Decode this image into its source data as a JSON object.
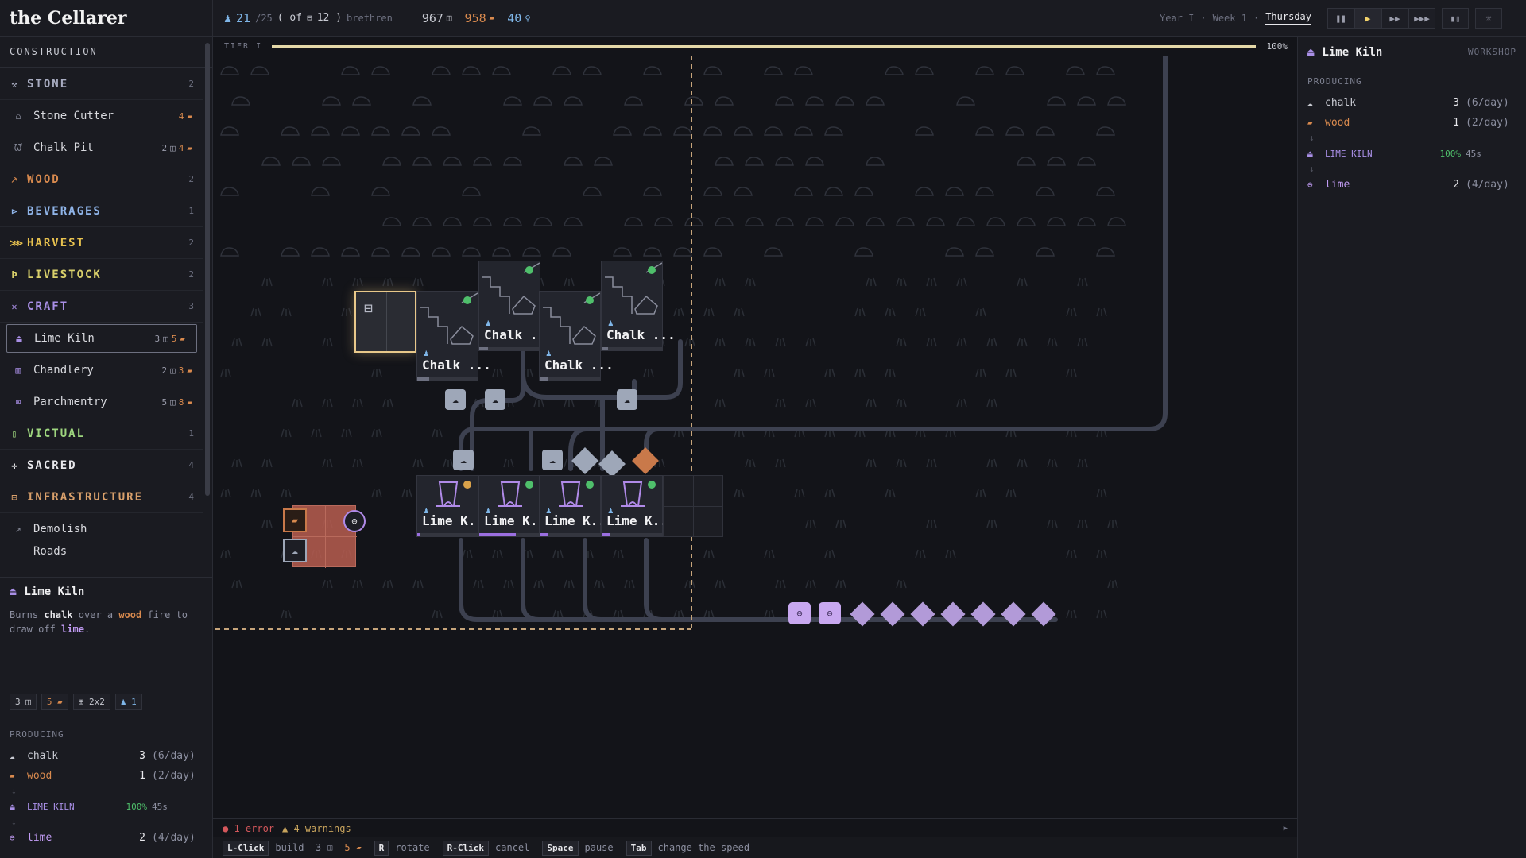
{
  "app": {
    "logo": "the Cellarer"
  },
  "topbar": {
    "population": "21",
    "population_max": "/25",
    "population_of": "( of",
    "population_beds": "12 )",
    "population_label": "brethren",
    "stone_amount": "967",
    "wood_amount": "958",
    "faith_amount": "40",
    "year": "Year I",
    "week": "Week 1",
    "day": "Thursday"
  },
  "tier": {
    "label": "TIER I",
    "percent": "100%",
    "progress": 1.0
  },
  "sidebar": {
    "section_label": "CONSTRUCTION",
    "categories": [
      {
        "name": "STONE",
        "count": "2",
        "color": "#a9adc2",
        "icon": "hammer-icon",
        "glyph": "⚒"
      },
      {
        "name": "WOOD",
        "count": "2",
        "color": "#d98a4e",
        "icon": "axe-icon",
        "glyph": "⸕"
      },
      {
        "name": "BEVERAGES",
        "count": "1",
        "color": "#8fb4e8",
        "icon": "keg-icon",
        "glyph": "⊳"
      },
      {
        "name": "HARVEST",
        "count": "2",
        "color": "#e8c24f",
        "icon": "sheaf-icon",
        "glyph": "⋙"
      },
      {
        "name": "LIVESTOCK",
        "count": "2",
        "color": "#d9d06b",
        "icon": "crook-icon",
        "glyph": "Ϸ"
      },
      {
        "name": "CRAFT",
        "count": "3",
        "color": "#a98fe6",
        "icon": "tools-icon",
        "glyph": "✕"
      },
      {
        "name": "VICTUAL",
        "count": "1",
        "color": "#9ed67f",
        "icon": "bottle-icon",
        "glyph": "▯"
      },
      {
        "name": "SACRED",
        "count": "4",
        "color": "#e8e8ec",
        "icon": "cross-icon",
        "glyph": "✜"
      },
      {
        "name": "INFRASTRUCTURE",
        "count": "4",
        "color": "#d9a06b",
        "icon": "cart-icon",
        "glyph": "⊟"
      }
    ],
    "stone_items": [
      {
        "name": "Stone Cutter",
        "stone": "",
        "wood": "4"
      },
      {
        "name": "Chalk Pit",
        "stone": "2",
        "wood": "4"
      }
    ],
    "craft_items": [
      {
        "name": "Lime Kiln",
        "stone": "3",
        "wood": "5"
      },
      {
        "name": "Chandlery",
        "stone": "2",
        "wood": "3"
      },
      {
        "name": "Parchmentry",
        "stone": "5",
        "wood": "8"
      }
    ],
    "demolish": "Demolish",
    "cut_off_item": "Roads"
  },
  "detail": {
    "title": "Lime Kiln",
    "desc_1": "Burns",
    "desc_chalk": "chalk",
    "desc_2": "over a",
    "desc_wood": "wood",
    "desc_3": "fire to draw off",
    "desc_lime": "lime",
    "desc_4": ".",
    "chip_stone": "3",
    "chip_wood": "5",
    "chip_size": "2x2",
    "chip_workers": "1"
  },
  "producing": {
    "label": "PRODUCING",
    "inputs": [
      {
        "name": "chalk",
        "qty": "3",
        "rate": "(6/day)",
        "color": "#c9cbd3"
      },
      {
        "name": "wood",
        "qty": "1",
        "rate": "(2/day)",
        "color": "#d98a4e"
      }
    ],
    "process": {
      "name": "LIME KILN",
      "percent": "100%",
      "time": "45s"
    },
    "output": {
      "name": "lime",
      "qty": "2",
      "rate": "(4/day)"
    }
  },
  "right_panel": {
    "title": "Lime Kiln",
    "kind": "WORKSHOP"
  },
  "buildings": {
    "chalk_label": "Chalk ...",
    "kiln_label": "Lime K..."
  },
  "status": {
    "errors": "1 error",
    "warnings": "4 warnings"
  },
  "keybar": {
    "lclick": "L-Click",
    "build": "build -3",
    "build_wood": "-5",
    "r": "R",
    "rotate": "rotate",
    "rclick": "R-Click",
    "cancel": "cancel",
    "space": "Space",
    "pause": "pause",
    "tab": "Tab",
    "speed": "change the speed"
  },
  "colors": {
    "accent": "#f3d36b",
    "stone": "#9a9cab",
    "wood": "#d98a4e",
    "lime": "#c29cf5",
    "worker": "#7fb6e8",
    "ok": "#4fbf6b",
    "warn": "#d9a24a",
    "error": "#d4575b"
  }
}
